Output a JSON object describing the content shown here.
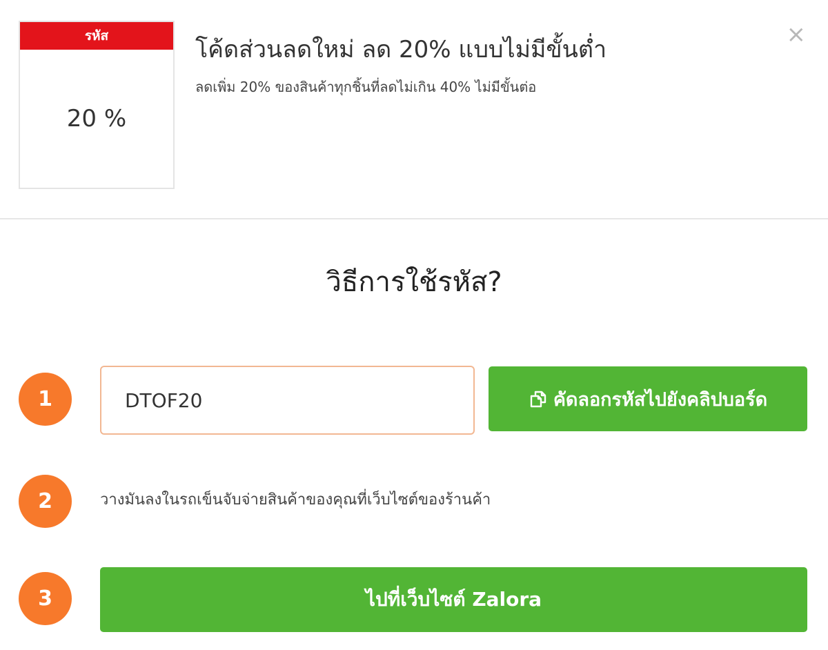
{
  "coupon": {
    "badge_label": "รหัส",
    "badge_value": "20 %",
    "title": "โค้ดส่วนลดใหม่ ลด 20% แบบไม่มีขั้นต่ำ",
    "description": "ลดเพิ่ม 20% ของสินค้าทุกชิ้นที่ลดไม่เกิน 40% ไม่มีขั้นต่อ",
    "close_symbol": "×",
    "accent_color": "#e3141b"
  },
  "howto": {
    "title": "วิธีการใช้รหัส?",
    "steps": [
      {
        "number": "1"
      },
      {
        "number": "2",
        "text": "วางมันลงในรถเข็นจับจ่ายสินค้าของคุณที่เว็บไซต์ของร้านค้า"
      },
      {
        "number": "3"
      }
    ],
    "code_value": "DTOF20",
    "copy_button_label": "คัดลอกรหัสไปยังคลิปบอร์ด",
    "copy_icon": "copy-icon",
    "go_button_label": "ไปที่เว็บไซต์ Zalora",
    "step_color": "#f7792b",
    "button_color": "#52b535"
  }
}
